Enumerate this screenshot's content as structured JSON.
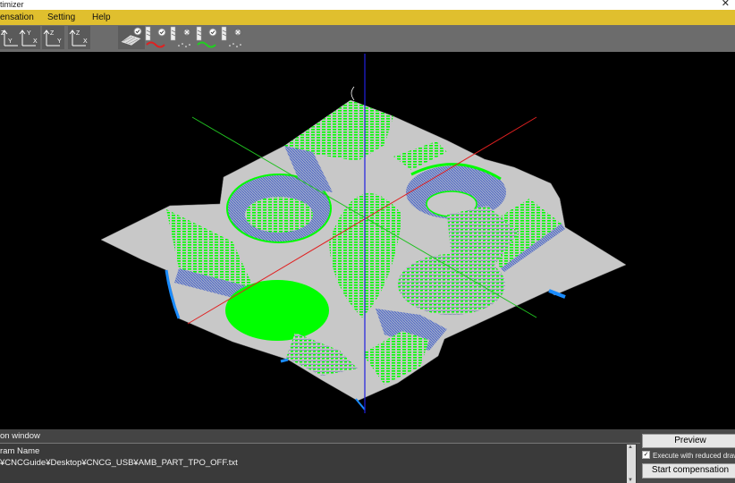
{
  "window": {
    "title": "timizer"
  },
  "menu": {
    "items": [
      "ensation",
      "Setting",
      "Help"
    ]
  },
  "toolbar": {
    "view_buttons": [
      {
        "icon": "view-zy-icon",
        "a": "Z",
        "b": "Y"
      },
      {
        "icon": "view-yx-icon",
        "a": "Y",
        "b": "X"
      },
      {
        "icon": "view-zy-iso-icon",
        "a": "Z",
        "b": "Y"
      },
      {
        "icon": "view-zx-icon",
        "a": "Z",
        "b": "X"
      }
    ],
    "tool_buttons": [
      "surface-display-icon",
      "tool-path-red-icon",
      "tool-path-points-icon",
      "tool-path-green-icon",
      "tool-path-dots-icon"
    ]
  },
  "viewport": {
    "axis_colors": {
      "x": "#e02020",
      "y": "#20c020",
      "z": "#2020e0"
    },
    "surface_color": "#c8c8c8",
    "path_color": "#00ff00",
    "edge_color": "#1a8cff"
  },
  "bottom": {
    "header": "on window",
    "program_label": "ram Name",
    "program_path": "¥CNCGuide¥Desktop¥CNCG_USB¥AMB_PART_TPO_OFF.txt"
  },
  "actions": {
    "preview": "Preview",
    "reduced_drawing": "Execute with reduced drawing",
    "start": "Start compensation"
  }
}
